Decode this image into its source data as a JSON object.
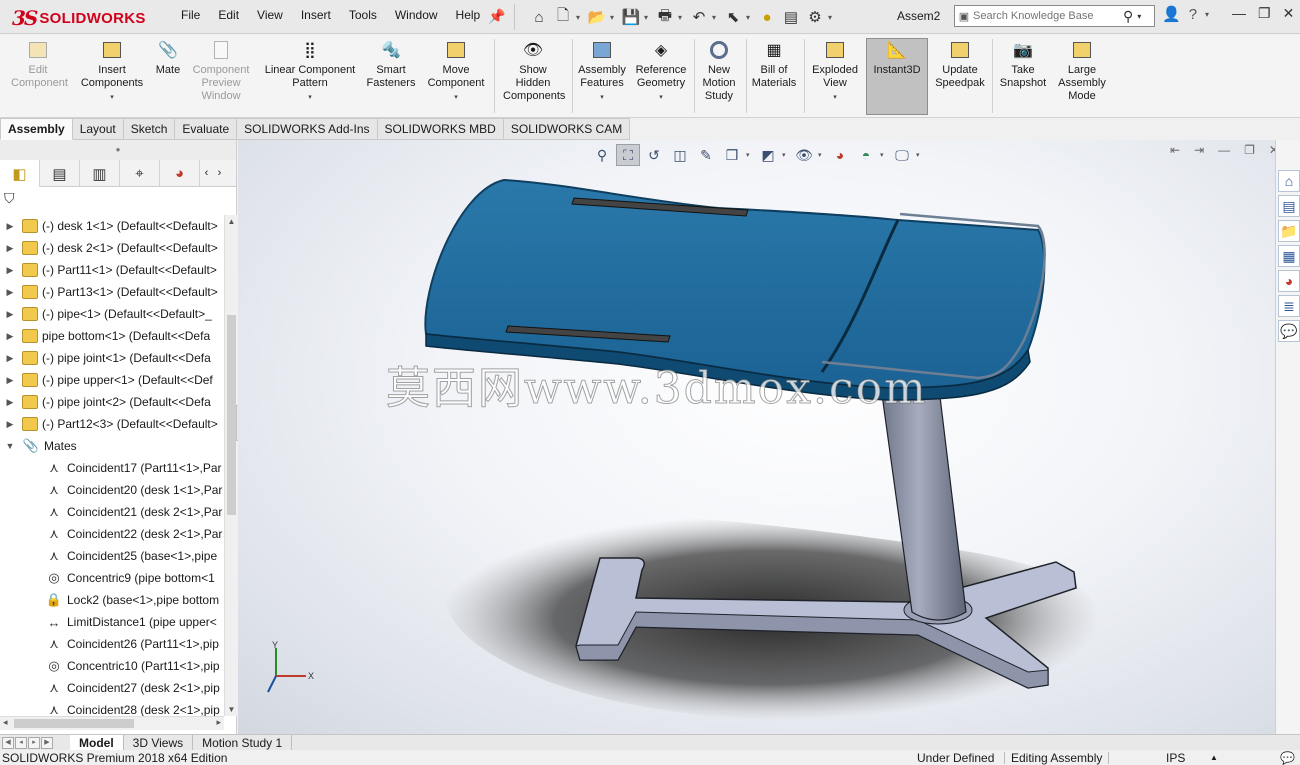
{
  "app": {
    "brand": "SOLIDWORKS",
    "document_title": "Assem2"
  },
  "menu": [
    "File",
    "Edit",
    "View",
    "Insert",
    "Tools",
    "Window",
    "Help"
  ],
  "search": {
    "placeholder": "Search Knowledge Base"
  },
  "ribbon": {
    "edit_component": "Edit Component",
    "insert_components": "Insert Components",
    "mate": "Mate",
    "component_preview": "Component Preview Window",
    "linear_pattern": "Linear Component Pattern",
    "smart_fasteners": "Smart Fasteners",
    "move_component": "Move Component",
    "show_hidden": "Show Hidden Components",
    "assembly_features": "Assembly Features",
    "reference_geometry": "Reference Geometry",
    "new_motion_study": "New Motion Study",
    "bill_of_materials": "Bill of Materials",
    "exploded_view": "Exploded View",
    "instant3d": "Instant3D",
    "update_speedpak": "Update Speedpak",
    "take_snapshot": "Take Snapshot",
    "large_assembly_mode": "Large Assembly Mode"
  },
  "cm_tabs": [
    "Assembly",
    "Layout",
    "Sketch",
    "Evaluate",
    "SOLIDWORKS Add-Ins",
    "SOLIDWORKS MBD",
    "SOLIDWORKS CAM"
  ],
  "tree": {
    "components": [
      "(-) desk 1<1> (Default<<Default>",
      "(-) desk 2<1> (Default<<Default>",
      "(-) Part11<1> (Default<<Default>",
      "(-) Part13<1> (Default<<Default>",
      "(-) pipe<1> (Default<<Default>_",
      "pipe bottom<1> (Default<<Defa",
      "(-) pipe joint<1> (Default<<Defa",
      "(-) pipe upper<1> (Default<<Def",
      "(-) pipe joint<2> (Default<<Defa",
      "(-) Part12<3> (Default<<Default>"
    ],
    "mates_label": "Mates",
    "mates": [
      {
        "icon": "coincident-icon",
        "label": "Coincident17 (Part11<1>,Par"
      },
      {
        "icon": "coincident-icon",
        "label": "Coincident20 (desk 1<1>,Par"
      },
      {
        "icon": "coincident-icon",
        "label": "Coincident21 (desk 2<1>,Par"
      },
      {
        "icon": "coincident-icon",
        "label": "Coincident22 (desk 2<1>,Par"
      },
      {
        "icon": "coincident-icon",
        "label": "Coincident25 (base<1>,pipe"
      },
      {
        "icon": "concentric-icon",
        "label": "Concentric9 (pipe bottom<1"
      },
      {
        "icon": "lock-icon",
        "label": "Lock2 (base<1>,pipe bottom"
      },
      {
        "icon": "limit-distance-icon",
        "label": "LimitDistance1 (pipe upper<"
      },
      {
        "icon": "coincident-icon",
        "label": "Coincident26 (Part11<1>,pip"
      },
      {
        "icon": "concentric-icon",
        "label": "Concentric10 (Part11<1>,pip"
      },
      {
        "icon": "coincident-icon",
        "label": "Coincident27 (desk 2<1>,pip"
      },
      {
        "icon": "coincident-icon",
        "label": "Coincident28 (desk 2<1>,pip"
      }
    ]
  },
  "watermark": "莫西网www.3dmox.com",
  "triad": {
    "x": "X",
    "y": "Y"
  },
  "bottom_tabs": [
    "Model",
    "3D Views",
    "Motion Study 1"
  ],
  "status": {
    "edition": "SOLIDWORKS Premium 2018 x64 Edition",
    "state": "Under Defined",
    "mode": "Editing Assembly",
    "units": "IPS"
  },
  "colors": {
    "desk_top": "#1f6fa0",
    "desk_edge": "#0e3f60",
    "metal": "#8e95a8",
    "base": "#b9bfd5",
    "brand_red": "#d0021b"
  }
}
